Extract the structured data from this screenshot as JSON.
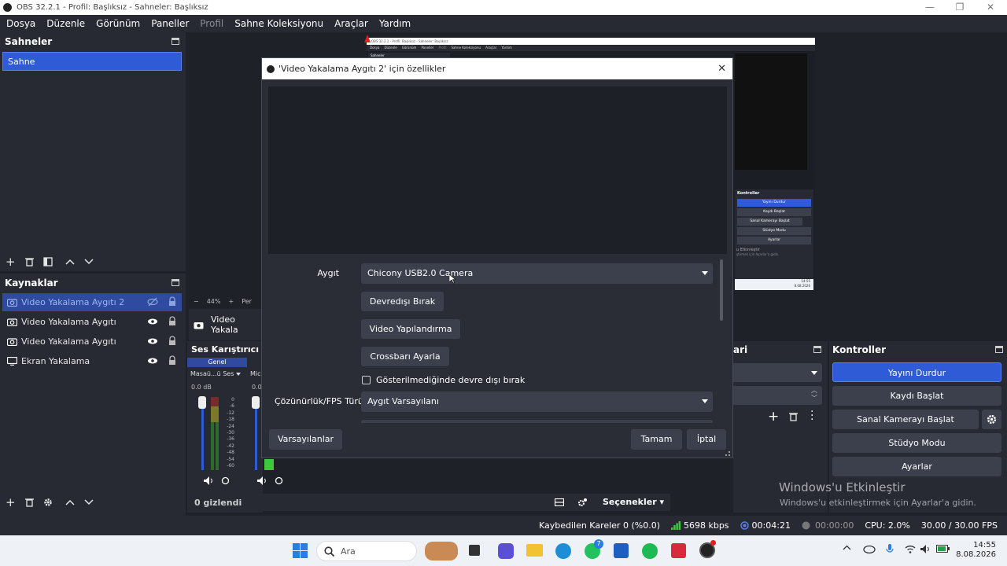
{
  "window": {
    "title": "OBS 32.2.1 - Profil: Başlıksız - Sahneler: Başlıksız"
  },
  "menu": [
    {
      "label": "Dosya",
      "dim": false
    },
    {
      "label": "Düzenle",
      "dim": false
    },
    {
      "label": "Görünüm",
      "dim": false
    },
    {
      "label": "Paneller",
      "dim": false
    },
    {
      "label": "Profil",
      "dim": true
    },
    {
      "label": "Sahne Koleksiyonu",
      "dim": false
    },
    {
      "label": "Araçlar",
      "dim": false
    },
    {
      "label": "Yardım",
      "dim": false
    }
  ],
  "scenes": {
    "title": "Sahneler",
    "items": [
      "Sahne"
    ]
  },
  "sources": {
    "title": "Kaynaklar",
    "items": [
      {
        "label": "Video Yakalama Aygıtı 2",
        "selected": true,
        "hidden": true,
        "icon": "camera-icon"
      },
      {
        "label": "Video Yakalama Aygıtı",
        "selected": false,
        "hidden": false,
        "icon": "camera-icon"
      },
      {
        "label": "Video Yakalama Aygıtı",
        "selected": false,
        "hidden": false,
        "icon": "camera-icon"
      },
      {
        "label": "Ekran Yakalama",
        "selected": false,
        "hidden": false,
        "icon": "monitor-icon"
      }
    ]
  },
  "preview": {
    "zoom": "44%",
    "per_label": "Per",
    "source_label": "Video Yakala"
  },
  "mixer": {
    "title": "Ses Karıştırıcı",
    "tab": "Genel",
    "ch1_name": "Masaü...ü Ses",
    "ch2_name": "Mic",
    "db": "0.0 dB",
    "db2": "0.0",
    "scale": [
      "0",
      "-6",
      "-12",
      "-18",
      "-24",
      "-30",
      "-36",
      "-42",
      "-48",
      "-54",
      "-60"
    ]
  },
  "bottom_bar": {
    "hidden_count": "0 gizlendi",
    "options": "Seçenekler"
  },
  "transitions": {
    "title_fragment": "ari"
  },
  "controls": {
    "title": "Kontroller",
    "stop_stream": "Yayını Durdur",
    "start_record": "Kaydı Başlat",
    "start_vcam": "Sanal Kamerayı Başlat",
    "studio_mode": "Stüdyo Modu",
    "settings": "Ayarlar"
  },
  "activation": {
    "title": "Windows'u Etkinleştir",
    "body": "Windows'u etkinleştirmek için Ayarlar'a gidin."
  },
  "status": {
    "dropped": "Kaybedilen Kareler 0 (%0.0)",
    "bitrate": "5698 kbps",
    "stream_time": "00:04:21",
    "rec_time": "00:00:00",
    "cpu": "CPU: 2.0%",
    "fps": "30.00 / 30.00 FPS"
  },
  "nested": {
    "title": "OBS 32.2.1 - Profil: Başlıksız - Sahneler: Başlıksız",
    "menu": [
      "Dosya",
      "Düzenle",
      "Görünüm",
      "Paneller",
      "Profil",
      "Sahne Koleksiyonu",
      "Araçlar",
      "Yardım"
    ],
    "scenes": "Sahneler",
    "controls": "Kontroller",
    "buttons": [
      "Yayını Durdur",
      "Kaydı Başlat",
      "Sanal Kamerayı Başlat",
      "Stüdyo Modu",
      "Ayarlar"
    ],
    "activation_title": "u Etkinleştir",
    "activation_body": "ştirmek için Ayarlar'a gidin.",
    "time": "14:55",
    "date": "8.08.2026"
  },
  "dialog": {
    "title": "'Video Yakalama Aygıtı 2' için özellikler",
    "device_label": "Aygıt",
    "device_value": "Chicony USB2.0 Camera",
    "btn_deactivate": "Devredışı Bırak",
    "btn_configure": "Video Yapılandırma",
    "btn_crossbar": "Crossbarı Ayarla",
    "checkbox_label": "Gösterilmediğinde devre dışı bırak",
    "res_label": "Çözünürlük/FPS Türü",
    "res_value": "Aygıt Varsayılanı",
    "defaults": "Varsayılanlar",
    "ok": "Tamam",
    "cancel": "İptal"
  },
  "taskbar": {
    "search": "Ara",
    "time": "14:55",
    "date": "8.08.2026",
    "whatsapp_badge": "7"
  }
}
